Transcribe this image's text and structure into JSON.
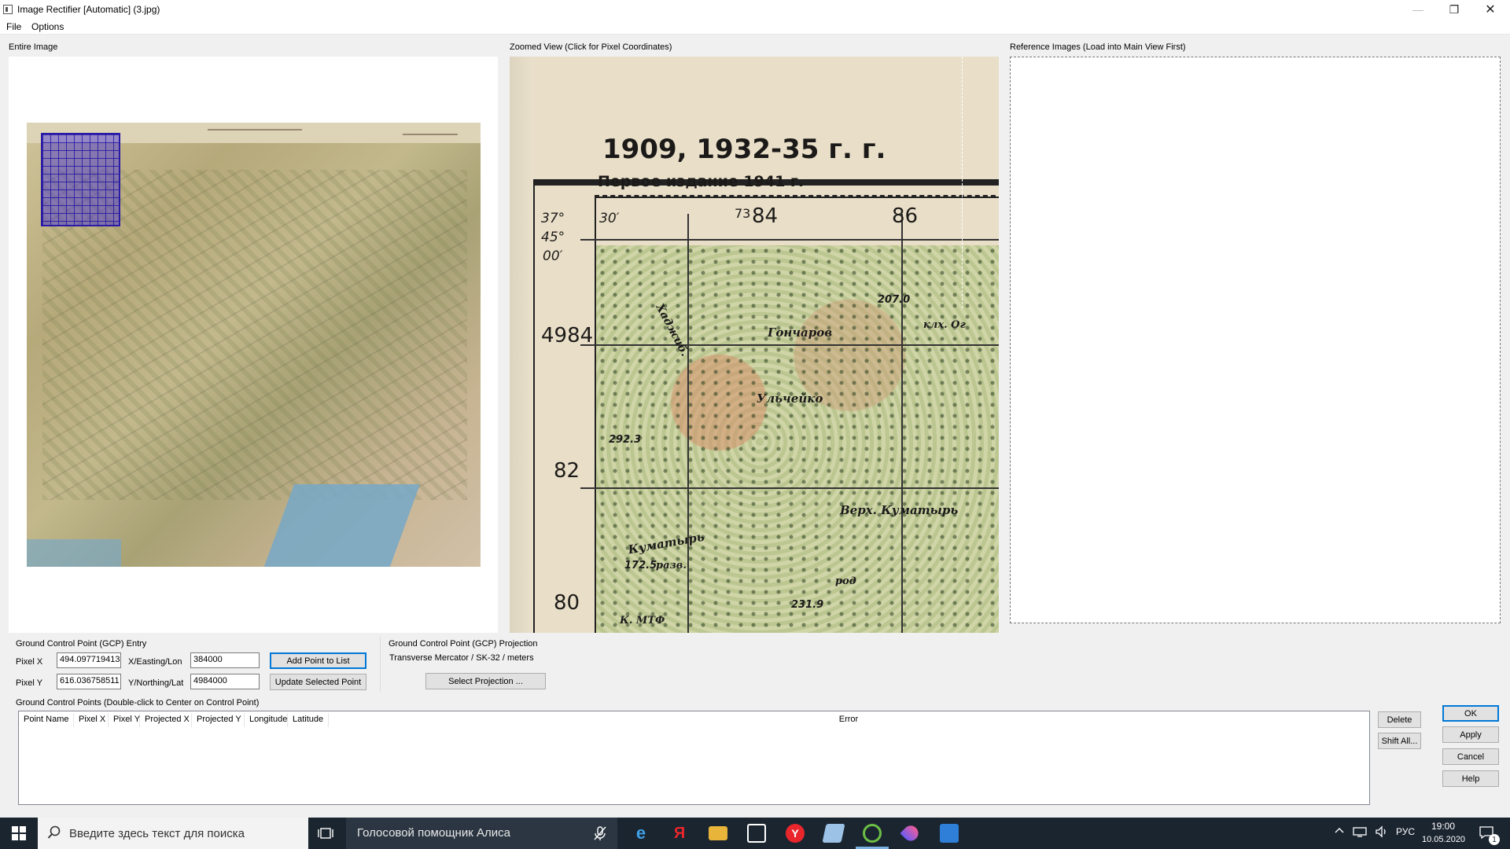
{
  "window": {
    "title": "Image Rectifier [Automatic] (3.jpg)"
  },
  "menu": {
    "file": "File",
    "options": "Options"
  },
  "panels": {
    "entire_image": "Entire Image",
    "zoomed_view": "Zoomed View (Click for Pixel Coordinates)",
    "reference_images": "Reference Images (Load into Main View First)"
  },
  "zoom_map": {
    "year_text": "1909, 1932-35 г. г.",
    "edition_text": "Первое издание 1941 г.",
    "lat_min_a": "37°",
    "lat_min_b": "30′",
    "lat_deg": "45°",
    "lat_min_c": "00′",
    "grid_73": "73",
    "grid_84_top": "84",
    "grid_86": "86",
    "grid_4984": "4984",
    "grid_82": "82",
    "grid_80": "80",
    "place_goncharov": "Гончаров",
    "place_ulcheiko": "Ульчейко",
    "place_kumatyr": "Куматырь",
    "place_verkh_kumatyr": "Верх. Куматырь",
    "place_klkh": "клх. Ог",
    "place_razv": "разв.",
    "place_rod": "род",
    "place_mtf": "К. МТФ",
    "place_khazhi": "Хаджиб.",
    "elev_207": "207.0",
    "elev_292": "292.3",
    "elev_172": "172.5",
    "elev_231": "231.9"
  },
  "gcp_entry": {
    "title": "Ground Control Point (GCP) Entry",
    "pixel_x_label": "Pixel X",
    "pixel_x_value": "494.097719413",
    "pixel_y_label": "Pixel Y",
    "pixel_y_value": "616.036758511",
    "x_label": "X/Easting/Lon",
    "x_value": "384000",
    "y_label": "Y/Northing/Lat",
    "y_value": "4984000",
    "add_button": "Add Point to List",
    "update_button": "Update Selected Point"
  },
  "gcp_projection": {
    "title": "Ground Control Point (GCP) Projection",
    "value": "Transverse Mercator / SK-32 / meters",
    "select_button": "Select Projection ..."
  },
  "gcp_list": {
    "title": "Ground Control Points (Double-click to Center on Control Point)",
    "columns": [
      "Point Name",
      "Pixel X",
      "Pixel Y",
      "Projected X",
      "Projected Y",
      "Longitude",
      "Latitude",
      "Error"
    ],
    "rows": []
  },
  "side_buttons": {
    "delete": "Delete",
    "shift_all": "Shift All..."
  },
  "dialog_buttons": {
    "ok": "OK",
    "apply": "Apply",
    "cancel": "Cancel",
    "help": "Help"
  },
  "taskbar": {
    "search_placeholder": "Введите здесь текст для поиска",
    "alice_label": "Голосовой помощник Алиса",
    "lang": "РУС",
    "time": "19:00",
    "date": "10.05.2020",
    "notification_count": "1",
    "icons": [
      "task-view-icon",
      "edge-icon",
      "yandex-browser-icon",
      "file-explorer-icon",
      "store-icon",
      "yandex-icon",
      "app-icon",
      "globe-app-icon",
      "paint-drop-icon",
      "image-app-icon"
    ]
  }
}
